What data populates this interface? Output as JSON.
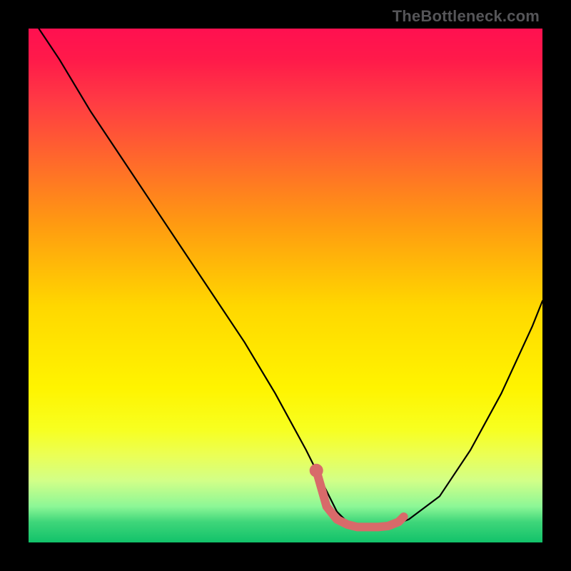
{
  "watermark": {
    "text": "TheBottleneck.com"
  },
  "colors": {
    "curve": "#000000",
    "highlight": "#d86a6a",
    "marker_fill": "#d86a6a",
    "marker_stroke": "#d86a6a"
  },
  "chart_data": {
    "type": "line",
    "title": "",
    "xlabel": "",
    "ylabel": "",
    "xlim": [
      0,
      100
    ],
    "ylim": [
      0,
      100
    ],
    "legend": false,
    "grid": false,
    "series": [
      {
        "name": "bottleneck-curve",
        "x": [
          2,
          6,
          12,
          18,
          24,
          30,
          36,
          42,
          48,
          54,
          56,
          58,
          60,
          62,
          64,
          66,
          68,
          70,
          74,
          80,
          86,
          92,
          98,
          100
        ],
        "y": [
          100,
          94,
          84,
          75,
          66,
          57,
          48,
          39,
          29,
          18,
          14,
          10,
          6,
          4,
          3,
          2.5,
          2.5,
          3,
          4.5,
          9,
          18,
          29,
          42,
          47
        ]
      }
    ],
    "highlight_band": {
      "name": "optimal-zone",
      "x": [
        56,
        58,
        60,
        62,
        64,
        66,
        68,
        70,
        72,
        73
      ],
      "y": [
        14,
        7,
        4.5,
        3.5,
        3,
        3,
        3,
        3.2,
        4,
        5
      ]
    },
    "highlight_marker": {
      "name": "optimal-start-marker",
      "x": 56,
      "y": 14
    }
  }
}
